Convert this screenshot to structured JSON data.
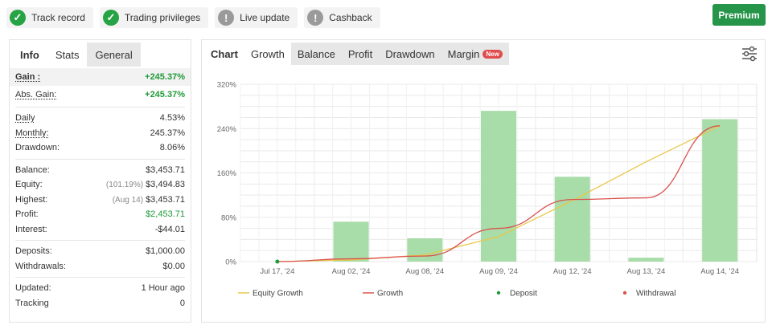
{
  "badges": [
    {
      "label": "Track record",
      "icon": "check-icon",
      "status": "ok"
    },
    {
      "label": "Trading privileges",
      "icon": "check-icon",
      "status": "ok"
    },
    {
      "label": "Live update",
      "icon": "exclamation-icon",
      "status": "warn"
    },
    {
      "label": "Cashback",
      "icon": "exclamation-icon",
      "status": "warn"
    }
  ],
  "premium_label": "Premium",
  "left_tabs": {
    "info": "Info",
    "stats": "Stats",
    "general": "General"
  },
  "stats": {
    "gain_label": "Gain :",
    "gain_value": "+245.37%",
    "abs_gain_label": "Abs. Gain:",
    "abs_gain_value": "+245.37%",
    "daily_label": "Daily",
    "daily_value": "4.53%",
    "monthly_label": "Monthly:",
    "monthly_value": "245.37%",
    "drawdown_label": "Drawdown:",
    "drawdown_value": "8.06%",
    "balance_label": "Balance:",
    "balance_value": "$3,453.71",
    "equity_label": "Equity:",
    "equity_note": "(101.19%)",
    "equity_value": "$3,494.83",
    "highest_label": "Highest:",
    "highest_note": "(Aug 14)",
    "highest_value": "$3,453.71",
    "profit_label": "Profit:",
    "profit_value": "$2,453.71",
    "interest_label": "Interest:",
    "interest_value": "-$44.01",
    "deposits_label": "Deposits:",
    "deposits_value": "$1,000.00",
    "withdrawals_label": "Withdrawals:",
    "withdrawals_value": "$0.00",
    "updated_label": "Updated:",
    "updated_value": "1 Hour ago",
    "tracking_label": "Tracking",
    "tracking_value": "0"
  },
  "chart_tabs": {
    "chart": "Chart",
    "growth": "Growth",
    "balance": "Balance",
    "profit": "Profit",
    "drawdown": "Drawdown",
    "margin": "Margin",
    "new_badge": "New"
  },
  "colors": {
    "bar": "#a8dca8",
    "equity_line": "#e8c84a",
    "growth_line": "#d9534f",
    "deposit": "#1f9a38",
    "withdrawal": "#d9534f",
    "premium": "#269449"
  },
  "chart_data": {
    "type": "bar",
    "categories": [
      "Jul 17, '24",
      "Aug 02, '24",
      "Aug 08, '24",
      "Aug 09, '24",
      "Aug 12, '24",
      "Aug 13, '24",
      "Aug 14, '24"
    ],
    "ylim": [
      0,
      320
    ],
    "yticks": [
      "0%",
      "80%",
      "160%",
      "240%",
      "320%"
    ],
    "series": [
      {
        "name": "Equity Growth",
        "type": "line",
        "values": [
          0,
          3,
          12,
          45,
          110,
          180,
          245
        ]
      },
      {
        "name": "Growth",
        "type": "line",
        "values": [
          0,
          5,
          10,
          60,
          112,
          115,
          245
        ]
      },
      {
        "name": "bars",
        "type": "bar",
        "values": [
          0,
          72,
          42,
          272,
          153,
          7,
          257
        ]
      }
    ],
    "legend": [
      "Equity Growth",
      "Growth",
      "Deposit",
      "Withdrawal"
    ],
    "deposit_points": [
      {
        "x": "Jul 17, '24",
        "y": 0
      }
    ],
    "grid": true,
    "legend_position": "bottom"
  }
}
